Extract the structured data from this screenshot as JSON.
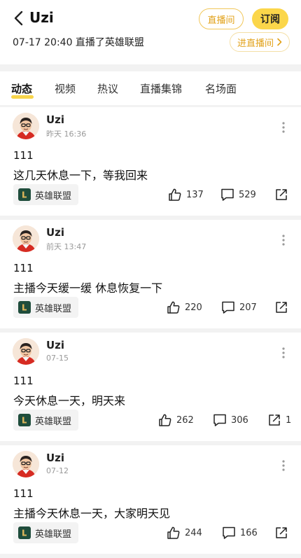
{
  "header": {
    "name": "Uzi",
    "live_room_btn": "直播间",
    "subscribe_btn": "订阅",
    "last_live": "07-17 20:40 直播了英雄联盟",
    "enter_live_btn": "进直播间"
  },
  "tabs": [
    "动态",
    "视频",
    "热议",
    "直播集锦",
    "名场面"
  ],
  "posts": [
    {
      "author": "Uzi",
      "time": "昨天 16:36",
      "line1": "111",
      "line2": "这几天休息一下，等我回来",
      "game": "英雄联盟",
      "likes": "137",
      "comments": "529",
      "shares": ""
    },
    {
      "author": "Uzi",
      "time": "前天 13:47",
      "line1": "111",
      "line2": "主播今天缓一缓 休息恢复一下",
      "game": "英雄联盟",
      "likes": "220",
      "comments": "207",
      "shares": ""
    },
    {
      "author": "Uzi",
      "time": "07-15",
      "line1": "111",
      "line2": "今天休息一天，明天来",
      "game": "英雄联盟",
      "likes": "262",
      "comments": "306",
      "shares": "1"
    },
    {
      "author": "Uzi",
      "time": "07-12",
      "line1": "111",
      "line2": "主播今天休息一天，大家明天见",
      "game": "英雄联盟",
      "likes": "244",
      "comments": "166",
      "shares": ""
    }
  ],
  "colors": {
    "accent": "#fbd64a",
    "accent_text": "#e2a21a",
    "background": "#f2f2f2"
  },
  "icons": [
    "back-icon",
    "chevron-right-icon",
    "more-icon",
    "thumbs-up-icon",
    "comment-icon",
    "share-icon",
    "lol-game-icon",
    "avatar"
  ]
}
